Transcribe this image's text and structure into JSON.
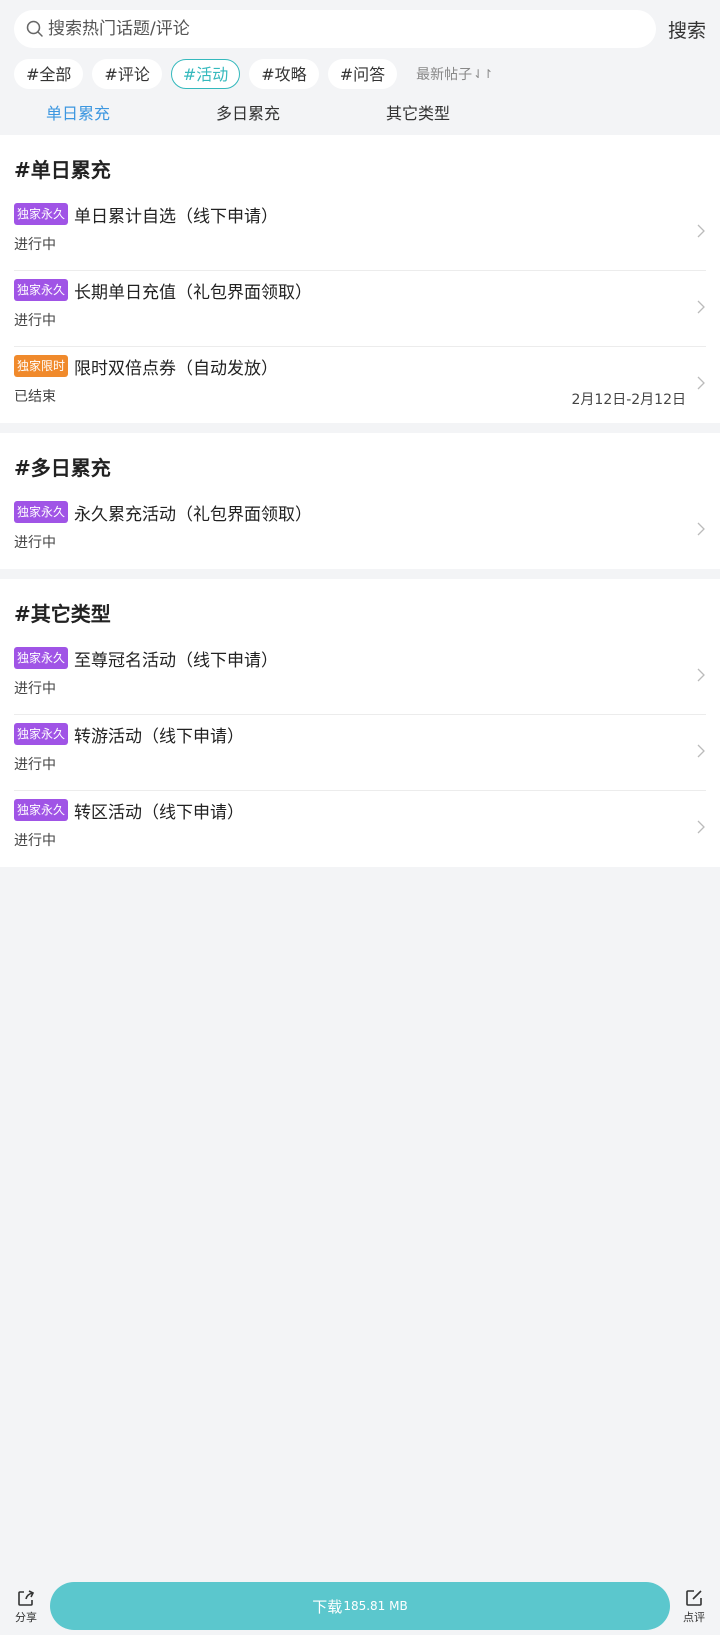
{
  "search": {
    "placeholder": "搜索热门话题/评论",
    "button_label": "搜索"
  },
  "tags": [
    {
      "label": "#全部",
      "active": false
    },
    {
      "label": "#评论",
      "active": false
    },
    {
      "label": "#活动",
      "active": true
    },
    {
      "label": "#攻略",
      "active": false
    },
    {
      "label": "#问答",
      "active": false
    }
  ],
  "sort": {
    "label": "最新帖子",
    "icon": "sort-icon"
  },
  "tabs": [
    {
      "label": "单日累充",
      "active": true
    },
    {
      "label": "多日累充",
      "active": false
    },
    {
      "label": "其它类型",
      "active": false
    }
  ],
  "sections": [
    {
      "title": "#单日累充",
      "items": [
        {
          "badge": "独家永久",
          "badge_color": "#a054e6",
          "title": "单日累计自选（线下申请）",
          "status": "进行中",
          "date": ""
        },
        {
          "badge": "独家永久",
          "badge_color": "#a054e6",
          "title": "长期单日充值（礼包界面领取）",
          "status": "进行中",
          "date": ""
        },
        {
          "badge": "独家限时",
          "badge_color": "#f08a2c",
          "title": "限时双倍点券（自动发放）",
          "status": "已结束",
          "date": "2月12日-2月12日"
        }
      ]
    },
    {
      "title": "#多日累充",
      "items": [
        {
          "badge": "独家永久",
          "badge_color": "#a054e6",
          "title": "永久累充活动（礼包界面领取）",
          "status": "进行中",
          "date": ""
        }
      ]
    },
    {
      "title": "#其它类型",
      "items": [
        {
          "badge": "独家永久",
          "badge_color": "#a054e6",
          "title": "至尊冠名活动（线下申请）",
          "status": "进行中",
          "date": ""
        },
        {
          "badge": "独家永久",
          "badge_color": "#a054e6",
          "title": "转游活动（线下申请）",
          "status": "进行中",
          "date": ""
        },
        {
          "badge": "独家永久",
          "badge_color": "#a054e6",
          "title": "转区活动（线下申请）",
          "status": "进行中",
          "date": ""
        }
      ]
    }
  ],
  "bottom": {
    "share_label": "分享",
    "download_label": "下载",
    "download_size": "185.81 MB",
    "review_label": "点评"
  },
  "colors": {
    "accent": "#35b9bd",
    "tab_active": "#3d97e0",
    "download_bg": "#5bc7cd"
  }
}
